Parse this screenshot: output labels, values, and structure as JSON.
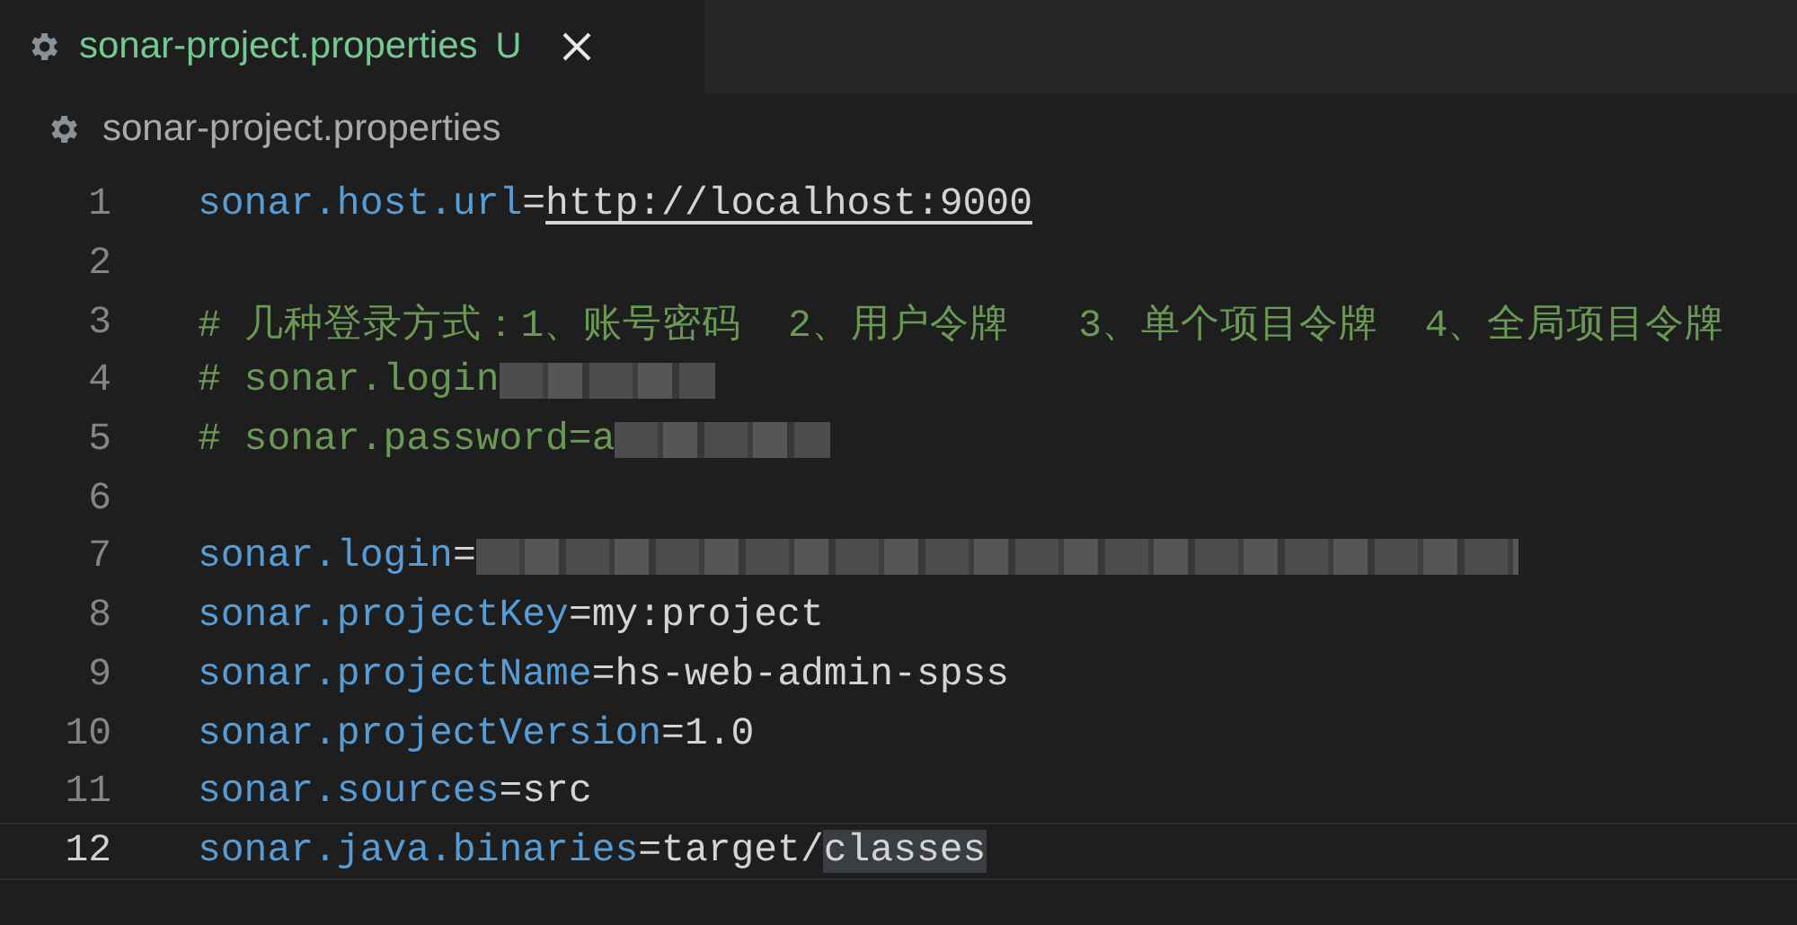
{
  "tab": {
    "title": "sonar-project.properties",
    "status": "U",
    "selected": true
  },
  "breadcrumb": {
    "file": "sonar-project.properties"
  },
  "lines": [
    {
      "number": "1",
      "kind": "property",
      "key": "sonar.host.url",
      "equals": "=",
      "value": "http://localhost:9000",
      "link": true,
      "current": false
    },
    {
      "number": "2",
      "kind": "blank",
      "current": false
    },
    {
      "number": "3",
      "kind": "comment",
      "text": "# 几种登录方式：1、账号密码  2、用户令牌   3、单个项目令牌  4、全局项目令牌",
      "current": false
    },
    {
      "number": "4",
      "kind": "comment",
      "text": "# sonar.login",
      "redacted": true,
      "current": false
    },
    {
      "number": "5",
      "kind": "comment",
      "text": "# sonar.password=a",
      "redacted": true,
      "current": false
    },
    {
      "number": "6",
      "kind": "blank",
      "current": false
    },
    {
      "number": "7",
      "kind": "property",
      "key": "sonar.login",
      "equals": "=",
      "redacted": true,
      "current": false
    },
    {
      "number": "8",
      "kind": "property",
      "key": "sonar.projectKey",
      "equals": "=",
      "value": "my:project",
      "current": false
    },
    {
      "number": "9",
      "kind": "property",
      "key": "sonar.projectName",
      "equals": "=",
      "value": "hs-web-admin-spss",
      "current": false
    },
    {
      "number": "10",
      "kind": "property",
      "key": "sonar.projectVersion",
      "equals": "=",
      "value": "1.0",
      "current": false
    },
    {
      "number": "11",
      "kind": "property",
      "key": "sonar.sources",
      "equals": "=",
      "value": "src",
      "current": false
    },
    {
      "number": "12",
      "kind": "property",
      "key": "sonar.java.binaries",
      "equals": "=",
      "value": "target/",
      "highlighted": "classes",
      "current": true
    }
  ]
}
